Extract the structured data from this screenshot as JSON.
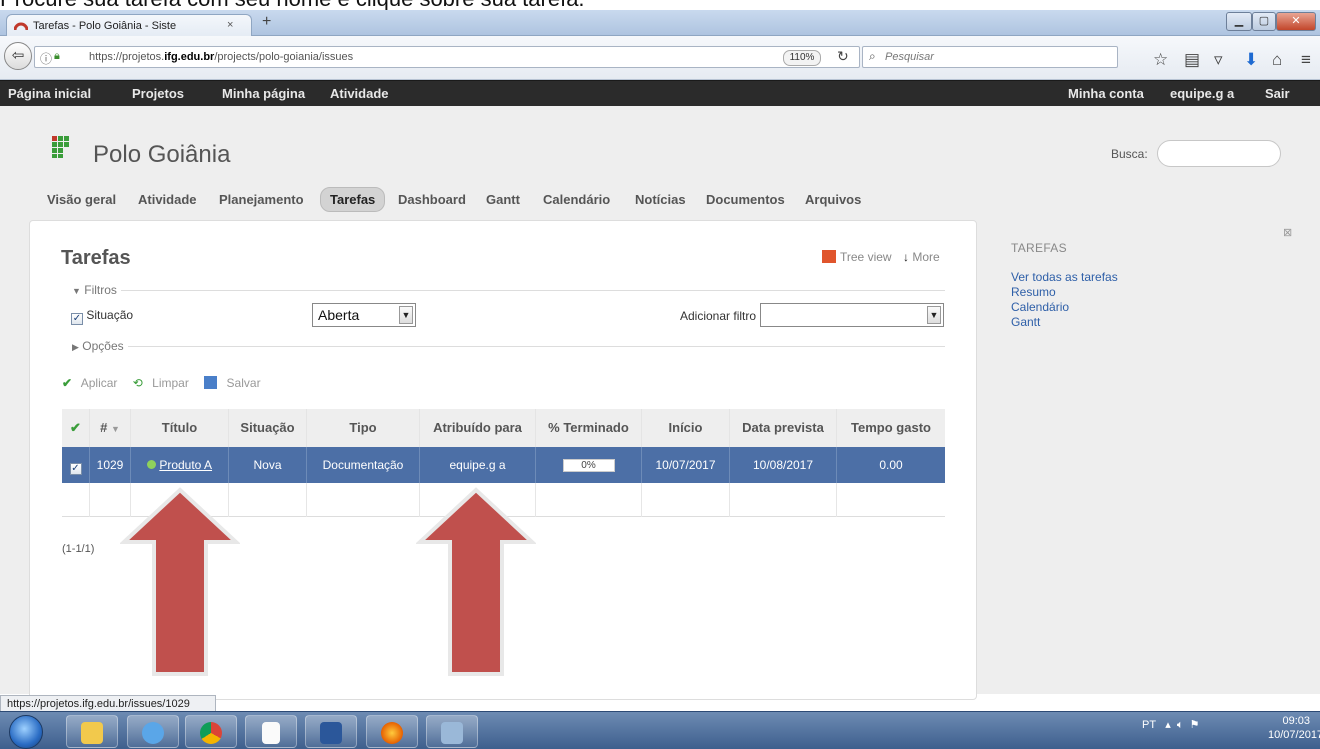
{
  "caption": "Procure sua tarefa com seu nome e clique sobre sua tarefa.",
  "browser": {
    "tab_title": "Tarefas - Polo Goiânia - Siste",
    "tab_close": "×",
    "new_tab": "+",
    "url_prefix": "https://projetos.",
    "url_domain": "ifg.edu.br",
    "url_path": "/projects/polo-goiania/issues",
    "zoom": "110%",
    "search_placeholder": "Pesquisar"
  },
  "topmenu": {
    "items": [
      "Página inicial",
      "Projetos",
      "Minha página",
      "Atividade"
    ],
    "right": [
      "Minha conta",
      "equipe.g a",
      "Sair"
    ]
  },
  "project": {
    "title": "Polo Goiânia",
    "search_label": "Busca:"
  },
  "tabs": [
    "Visão geral",
    "Atividade",
    "Planejamento",
    "Tarefas",
    "Dashboard",
    "Gantt",
    "Calendário",
    "Notícias",
    "Documentos",
    "Arquivos"
  ],
  "issues": {
    "heading": "Tarefas",
    "tree_view": "Tree view",
    "more": "More",
    "filters_legend": "Filtros",
    "filter_status_label": "Situação",
    "filter_status_value": "Aberta",
    "add_filter_label": "Adicionar filtro",
    "options_legend": "Opções",
    "apply": "Aplicar",
    "clear": "Limpar",
    "save": "Salvar",
    "columns": [
      "",
      "#",
      "Título",
      "Situação",
      "Tipo",
      "Atribuído para",
      "% Terminado",
      "Início",
      "Data prevista",
      "Tempo gasto"
    ],
    "rows": [
      {
        "id": "1029",
        "title": "Produto A",
        "status": "Nova",
        "tracker": "Documentação",
        "assignee": "equipe.g a",
        "done": "0%",
        "done_ratio": 0,
        "start": "10/07/2017",
        "due": "10/08/2017",
        "spent": "0.00"
      }
    ],
    "count": "(1-1/1)"
  },
  "sidebar": {
    "heading": "TAREFAS",
    "links": [
      "Ver todas as tarefas",
      "Resumo",
      "Calendário",
      "Gantt"
    ]
  },
  "statusbar": "https://projetos.ifg.edu.br/issues/1029",
  "taskbar": {
    "lang": "PT",
    "time": "09:03",
    "date": "10/07/2017"
  },
  "colors": {
    "selected_row": "#4c6fa6",
    "arrow": "#c0504d",
    "topmenu": "#2b2b2b"
  }
}
